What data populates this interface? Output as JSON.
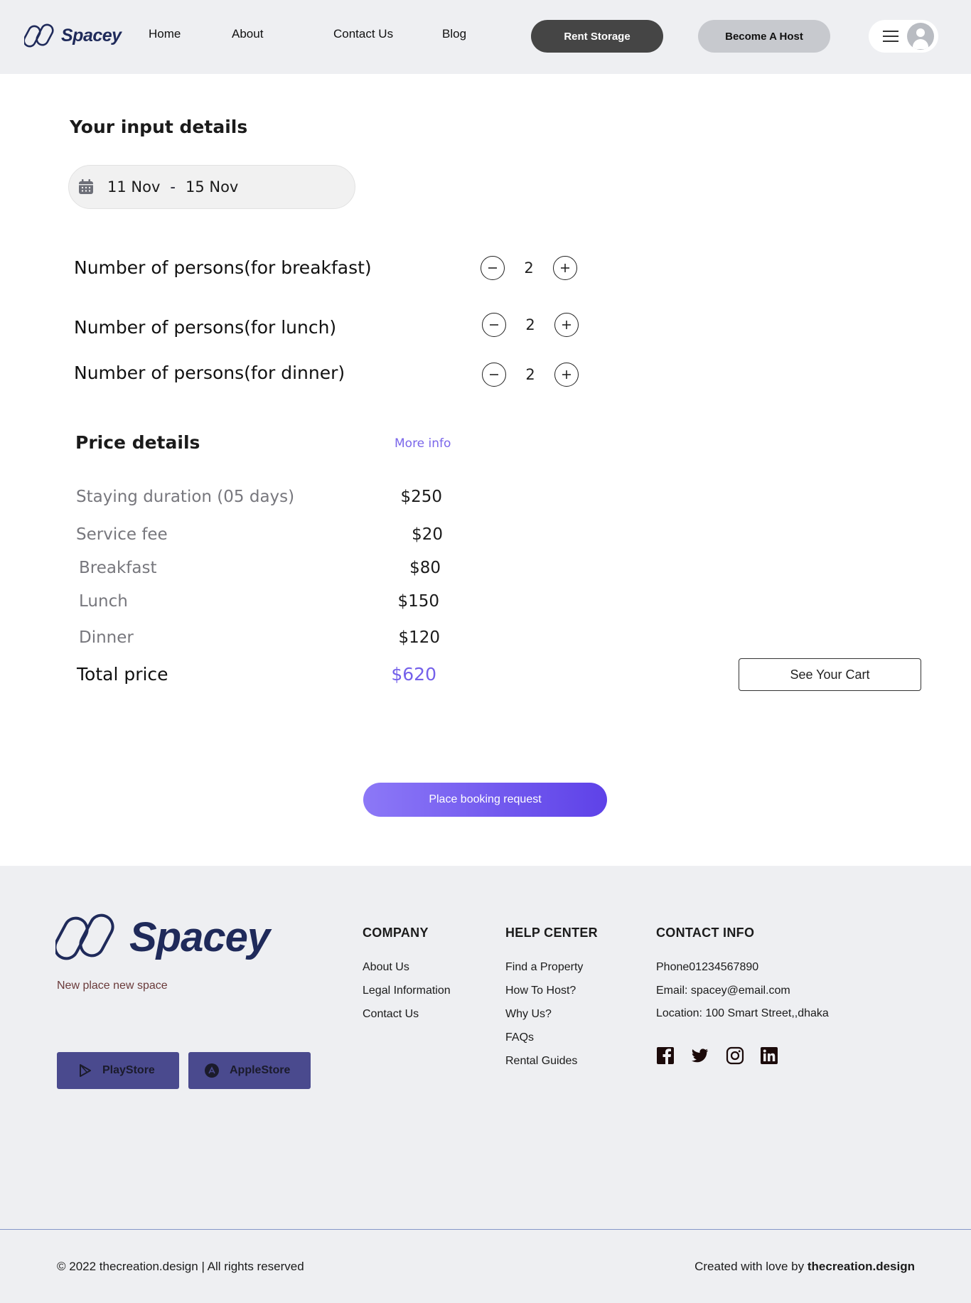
{
  "nav": {
    "logo_text": "Spacey",
    "links": [
      "Home",
      "About",
      "Contact Us",
      "Blog"
    ],
    "rent_label": "Rent Storage",
    "host_label": "Become A Host"
  },
  "booking": {
    "section_title": "Your input details",
    "date_from": "11 Nov",
    "date_separator": "-",
    "date_to": "15 Nov",
    "persons": [
      {
        "label": "Number of persons(for breakfast)",
        "value": "2"
      },
      {
        "label": "Number of persons(for lunch)",
        "value": "2"
      },
      {
        "label": "Number of persons(for dinner)",
        "value": "2"
      }
    ]
  },
  "price": {
    "title": "Price details",
    "more_info": "More info",
    "items": [
      {
        "label": "Staying duration (05 days)",
        "value": "$250"
      },
      {
        "label": "Service fee",
        "value": "$20"
      },
      {
        "label": "Breakfast",
        "value": "$80"
      },
      {
        "label": "Lunch",
        "value": "$150"
      },
      {
        "label": "Dinner",
        "value": "$120"
      }
    ],
    "total_label": "Total price",
    "total_value": "$620",
    "cart_label": "See Your Cart",
    "book_label": "Place booking request"
  },
  "footer": {
    "logo_text": "Spacey",
    "tagline": "New place new  space",
    "playstore_label": "PlayStore",
    "applestore_label": "AppleStore",
    "company": {
      "heading": "COMPANY",
      "links": [
        "About Us",
        "Legal Information",
        "Contact Us"
      ]
    },
    "help": {
      "heading": "HELP CENTER",
      "links": [
        "Find a Property",
        "How To Host?",
        "Why Us?",
        "FAQs",
        "Rental Guides"
      ]
    },
    "contact": {
      "heading": "CONTACT INFO",
      "phone": "Phone01234567890",
      "email": "Email: spacey@email.com",
      "location": "Location: 100 Smart Street,,dhaka"
    },
    "social_icons": [
      "facebook-icon",
      "twitter-icon",
      "instagram-icon",
      "linkedin-icon"
    ],
    "copyright": "© 2022 thecreation.design | All rights reserved",
    "credits_prefix": "Created with love by",
    "credits_brand": "thecreation.design"
  },
  "colors": {
    "accent": "#7460ea",
    "nav_bg": "#eeeff2",
    "rent_button": "#454545",
    "host_button": "#c7c9ce",
    "store_button": "#4a4a8e",
    "logo": "#1f2a5a"
  }
}
